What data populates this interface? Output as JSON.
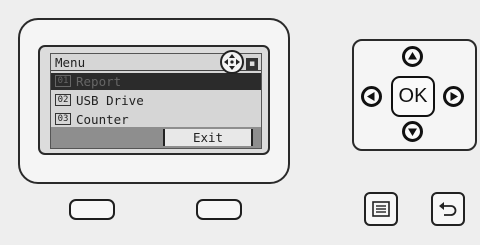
{
  "screen": {
    "title": "Menu",
    "items": [
      {
        "num": "01",
        "label": "Report",
        "selected": true
      },
      {
        "num": "02",
        "label": "USB Drive",
        "selected": false
      },
      {
        "num": "03",
        "label": "Counter",
        "selected": false
      }
    ],
    "exit_label": "Exit",
    "scroll_glyph": "▪"
  },
  "dpad": {
    "ok_label": "OK",
    "up_icon": "arrow-up-icon",
    "down_icon": "arrow-down-icon",
    "left_icon": "arrow-left-icon",
    "right_icon": "arrow-right-icon"
  },
  "buttons": {
    "menu_icon": "menu-list-icon",
    "back_icon": "back-arrow-icon",
    "nav_icon": "four-way-arrows-icon"
  },
  "colors": {
    "highlight": "#2b2b2b",
    "lcd_bg": "#d6d6d6",
    "softbar": "#8e8e8e"
  }
}
